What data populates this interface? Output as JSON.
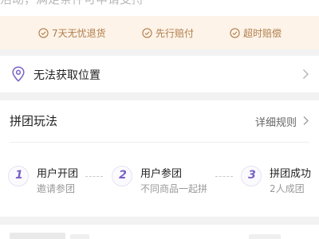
{
  "top": {
    "cut_text": "活动，满足条件可申请支持"
  },
  "guarantees": [
    {
      "label": "7天无忧退货",
      "icon": "check-circle-icon"
    },
    {
      "label": "先行赔付",
      "icon": "check-circle-icon"
    },
    {
      "label": "超时赔偿",
      "icon": "check-circle-icon"
    }
  ],
  "location": {
    "icon": "location-pin-icon",
    "label": "无法获取位置"
  },
  "group_buy": {
    "title": "拼团玩法",
    "rules_label": "详细规则",
    "steps": [
      {
        "number": "1",
        "title": "用户开团",
        "subtitle": "邀请参团"
      },
      {
        "number": "2",
        "title": "用户参团",
        "subtitle": "不同商品一起拼"
      },
      {
        "number": "3",
        "title": "拼团成功",
        "subtitle": "2人成团"
      }
    ]
  },
  "colors": {
    "accent_purple": "#7a5fc7",
    "guarantee_bg": "#fdf3e8",
    "guarantee_text": "#b07c4a"
  }
}
